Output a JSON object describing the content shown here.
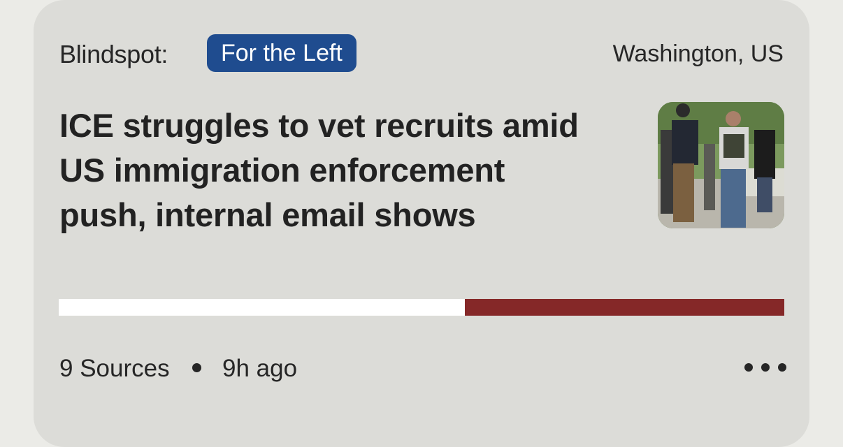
{
  "blindspot": {
    "label": "Blindspot:",
    "lean_badge": "For the Left",
    "lean_badge_color": "#1f4c8f"
  },
  "location": "Washington, US",
  "headline": "ICE struggles to vet recruits amid US immigration enforcement push, internal email shows",
  "thumbnail": {
    "icon": "news-photo-thumbnail"
  },
  "bias_bar": {
    "left_fraction": 0.56,
    "right_fraction": 0.44,
    "left_color": "#ffffff",
    "right_color": "#852828"
  },
  "footer": {
    "sources": "9 Sources",
    "time": "9h ago",
    "more_icon": "more-dots-icon"
  }
}
